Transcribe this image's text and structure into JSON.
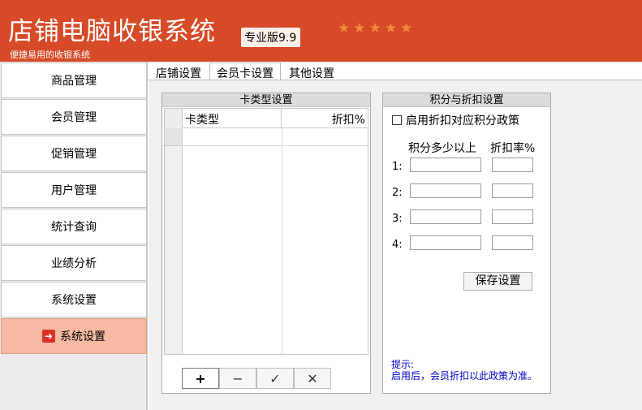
{
  "header": {
    "title": "店铺电脑收银系统",
    "edition": "专业版9.9",
    "stars": "★★★★★",
    "tagline": "便捷易用的收银系统"
  },
  "sidebar": {
    "items": [
      {
        "label": "商品管理"
      },
      {
        "label": "会员管理"
      },
      {
        "label": "促销管理"
      },
      {
        "label": "用户管理"
      },
      {
        "label": "统计查询"
      },
      {
        "label": "业绩分析"
      },
      {
        "label": "系统设置"
      },
      {
        "label": "系统设置",
        "active": true
      }
    ],
    "active_icon": "arrow-right-icon"
  },
  "tabs": [
    {
      "label": "店铺设置"
    },
    {
      "label": "会员卡设置",
      "active": true
    },
    {
      "label": "其他设置"
    }
  ],
  "card_types": {
    "title": "卡类型设置",
    "columns": [
      "卡类型",
      "折扣%"
    ],
    "rows": [],
    "toolbar": [
      "+",
      "−",
      "✓",
      "✕"
    ]
  },
  "points": {
    "title": "积分与折扣设置",
    "enable_label": "启用折扣对应积分政策",
    "enable_checked": false,
    "points_header": "积分多少以上",
    "rate_header": "折扣率%",
    "levels": [
      "1:",
      "2:",
      "3:",
      "4:"
    ],
    "save_label": "保存设置",
    "tip_title": "提示:",
    "tip_text": "启用后，会员折扣以此政策为准。"
  },
  "colors": {
    "header": "#d64a27",
    "active_sidebar": "#f6b9a1",
    "tip": "#0000c8"
  }
}
